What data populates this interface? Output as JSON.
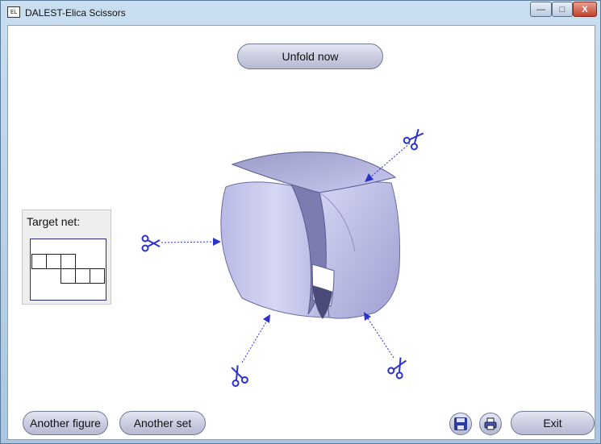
{
  "window": {
    "title": "DALEST-Elica Scissors",
    "icon_text": "EL",
    "controls": {
      "minimize": "—",
      "maximize": "□",
      "close": "X"
    }
  },
  "toolbar": {
    "unfold_label": "Unfold now"
  },
  "target_net": {
    "label": "Target net:"
  },
  "footer": {
    "another_figure_label": "Another figure",
    "another_set_label": "Another set",
    "save_icon": "save-icon",
    "print_icon": "print-icon",
    "exit_label": "Exit"
  },
  "colors": {
    "cube_fill": "#c5c6ec",
    "cube_edge": "#5a5c90",
    "scissors": "#2b33c8",
    "accent_blue": "#2a2a8a"
  },
  "scene": {
    "scissors_icons": [
      "scissors-icon",
      "scissors-icon",
      "scissors-icon",
      "scissors-icon"
    ]
  }
}
